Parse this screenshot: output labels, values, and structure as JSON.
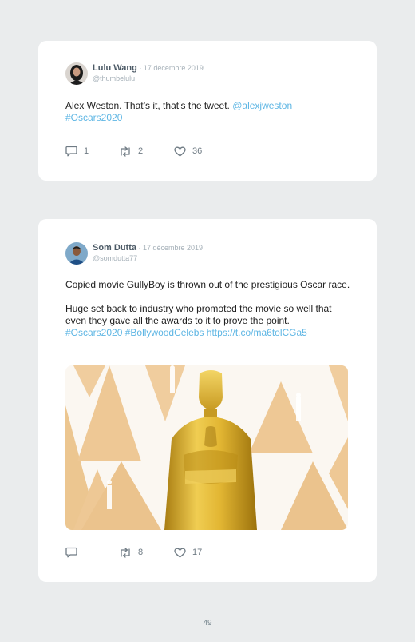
{
  "tweets": [
    {
      "name": "Lulu Wang",
      "date": " · 17 décembre 2019",
      "handle": "@thumbelulu",
      "text_plain": "Alex Weston. That’s it, that’s the tweet. ",
      "mention": "@alexjweston",
      "hashtag": "#Oscars2020",
      "replies": "1",
      "retweets": "2",
      "likes": "36"
    },
    {
      "name": "Som Dutta",
      "date": " · 17 décembre 2019",
      "handle": "@somdutta77",
      "text_p1": "Copied movie GullyBoy is thrown out of the prestigious Oscar race.",
      "text_p2": "Huge set back to industry who promoted the movie so well that even they gave all the awards to it to prove the point.",
      "hashtag1": "#Oscars2020",
      "hashtag2": "#BollywoodCelebs",
      "url": "https://t.co/ma6tolCGa5",
      "replies": "",
      "retweets": "8",
      "likes": "17"
    }
  ],
  "page_number": "49",
  "colors": {
    "background": "#eaeced",
    "card": "#ffffff",
    "link": "#5eb6e4",
    "name": "#4c5a66",
    "muted": "#a5b0b8"
  },
  "icons": [
    "reply-icon",
    "retweet-icon",
    "like-icon"
  ]
}
